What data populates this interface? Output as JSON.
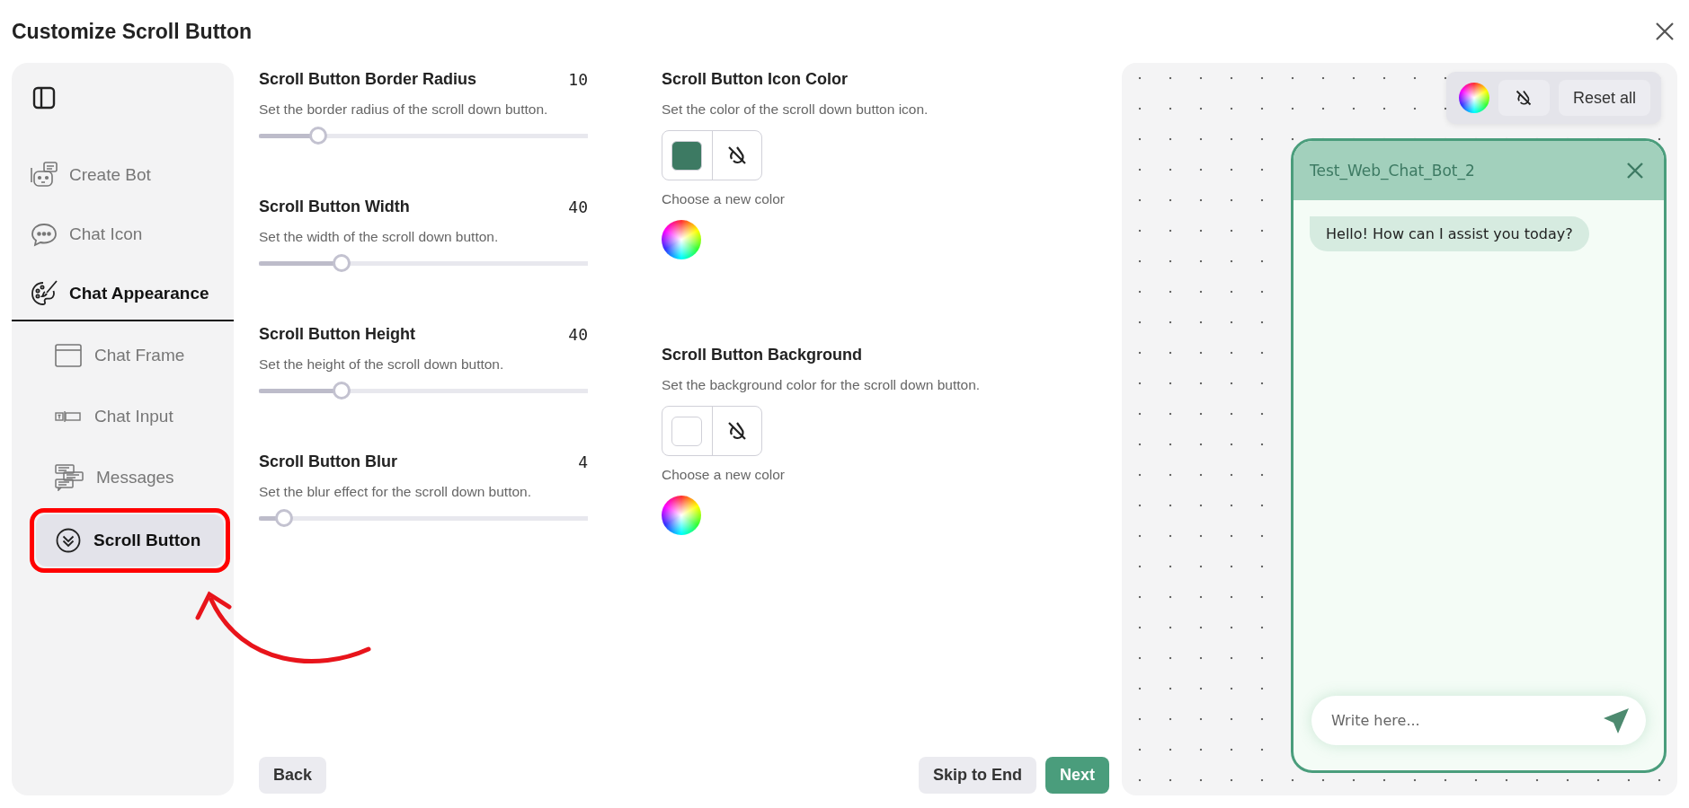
{
  "window": {
    "title": "Customize Scroll Button"
  },
  "sidebar": {
    "items": [
      {
        "label": "Create Bot",
        "kind": "bot",
        "selected": false,
        "expanded": false
      },
      {
        "label": "Chat Icon",
        "kind": "bubble",
        "selected": false,
        "expanded": false
      },
      {
        "label": "Chat Appearance",
        "kind": "palette",
        "selected": false,
        "expanded": true,
        "children": [
          {
            "label": "Chat Frame",
            "kind": "frame",
            "selected": false
          },
          {
            "label": "Chat Input",
            "kind": "input",
            "selected": false
          },
          {
            "label": "Messages",
            "kind": "messages",
            "selected": false
          },
          {
            "label": "Scroll Button",
            "kind": "scroll",
            "selected": true
          }
        ]
      }
    ]
  },
  "sliders": [
    {
      "title": "Scroll Button Border Radius",
      "value": "10",
      "description": "Set the border radius of the scroll down button.",
      "level": 0.18
    },
    {
      "title": "Scroll Button Width",
      "value": "40",
      "description": "Set the width of the scroll down button.",
      "level": 0.25
    },
    {
      "title": "Scroll Button Height",
      "value": "40",
      "description": "Set the height of the scroll down button.",
      "level": 0.25
    },
    {
      "title": "Scroll Button Blur",
      "value": "4",
      "description": "Set the blur effect for the scroll down button.",
      "level": 0.077
    }
  ],
  "color_settings": [
    {
      "title": "Scroll Button Icon Color",
      "description": "Set the color of the scroll down button icon.",
      "color": "#3d7a63",
      "picker_label": "Choose a new color"
    },
    {
      "title": "Scroll Button Background",
      "description": "Set the background color for the scroll down button.",
      "color": "#ffffff",
      "picker_label": "Choose a new color"
    }
  ],
  "footer": {
    "back": "Back",
    "skip": "Skip to End",
    "next": "Next"
  },
  "preview": {
    "toolbar": {
      "reset": "Reset all"
    },
    "chat": {
      "title": "Test_Web_Chat_Bot_2",
      "messages": [
        "Hello! How can I assist you today?"
      ],
      "input": {
        "placeholder": "Write here..."
      }
    }
  }
}
